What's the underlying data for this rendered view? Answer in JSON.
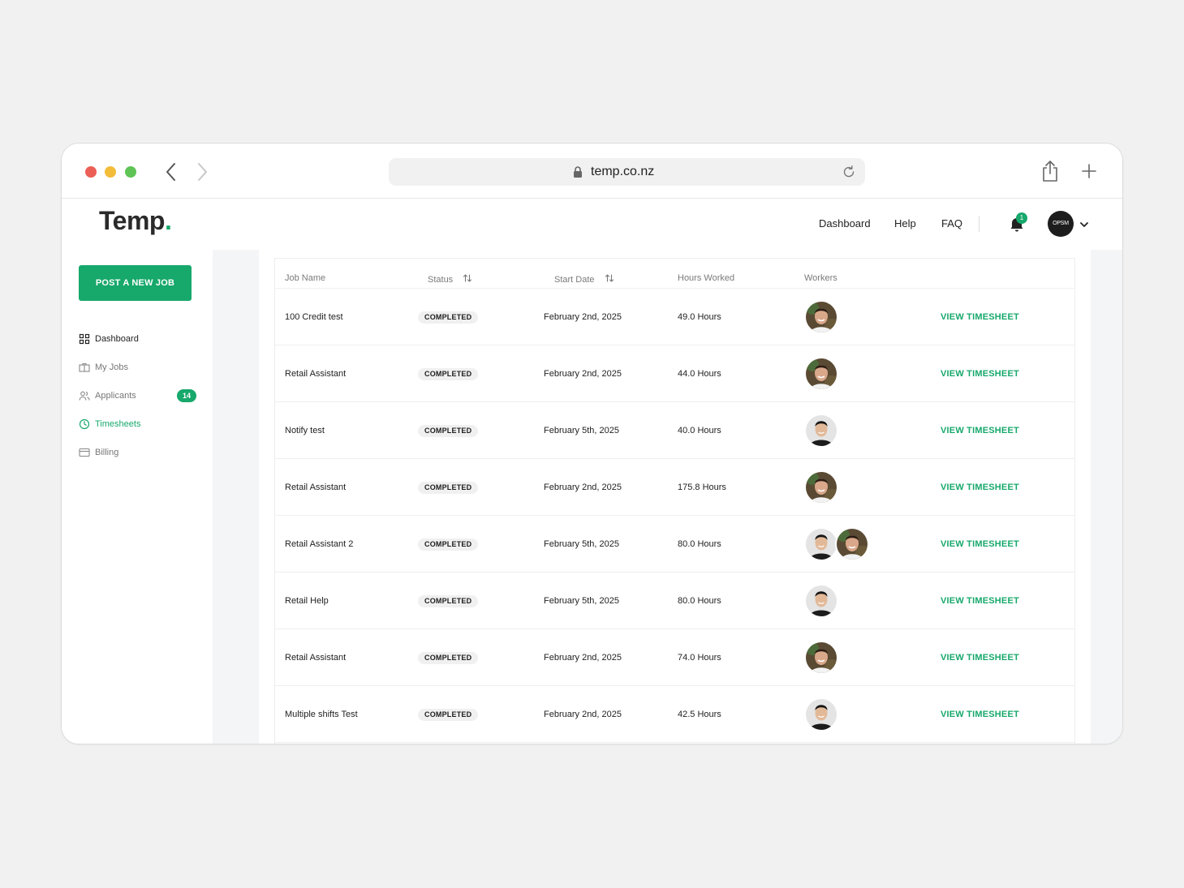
{
  "browser": {
    "url": "temp.co.nz"
  },
  "header": {
    "logo": "Temp",
    "logo_dot": ".",
    "nav": [
      "Dashboard",
      "Help",
      "FAQ"
    ],
    "notification_count": "1",
    "account_avatar": "OPSM"
  },
  "sidebar": {
    "post_button": "POST A NEW JOB",
    "items": [
      {
        "label": "Dashboard",
        "icon": "grid-icon"
      },
      {
        "label": "My Jobs",
        "icon": "briefcase-icon"
      },
      {
        "label": "Applicants",
        "icon": "users-icon",
        "badge": "14"
      },
      {
        "label": "Timesheets",
        "icon": "clock-icon"
      },
      {
        "label": "Billing",
        "icon": "card-icon"
      }
    ]
  },
  "table": {
    "columns": [
      "Job Name",
      "Status",
      "Start Date",
      "Hours Worked",
      "Workers"
    ],
    "rows": [
      {
        "job": "100 Credit test",
        "status": "COMPLETED",
        "start": "February 2nd, 2025",
        "hours": "49.0 Hours",
        "workers": [
          "A"
        ],
        "action": "VIEW TIMESHEET"
      },
      {
        "job": "Retail Assistant",
        "status": "COMPLETED",
        "start": "February 2nd, 2025",
        "hours": "44.0 Hours",
        "workers": [
          "A"
        ],
        "action": "VIEW TIMESHEET"
      },
      {
        "job": "Notify test",
        "status": "COMPLETED",
        "start": "February 5th, 2025",
        "hours": "40.0 Hours",
        "workers": [
          "B"
        ],
        "action": "VIEW TIMESHEET"
      },
      {
        "job": "Retail Assistant",
        "status": "COMPLETED",
        "start": "February 2nd, 2025",
        "hours": "175.8 Hours",
        "workers": [
          "A"
        ],
        "action": "VIEW TIMESHEET"
      },
      {
        "job": "Retail Assistant 2",
        "status": "COMPLETED",
        "start": "February 5th, 2025",
        "hours": "80.0 Hours",
        "workers": [
          "B",
          "A"
        ],
        "action": "VIEW TIMESHEET"
      },
      {
        "job": "Retail Help",
        "status": "COMPLETED",
        "start": "February 5th, 2025",
        "hours": "80.0 Hours",
        "workers": [
          "B"
        ],
        "action": "VIEW TIMESHEET"
      },
      {
        "job": "Retail Assistant",
        "status": "COMPLETED",
        "start": "February 2nd, 2025",
        "hours": "74.0 Hours",
        "workers": [
          "A"
        ],
        "action": "VIEW TIMESHEET"
      },
      {
        "job": "Multiple shifts Test",
        "status": "COMPLETED",
        "start": "February 2nd, 2025",
        "hours": "42.5 Hours",
        "workers": [
          "B"
        ],
        "action": "VIEW TIMESHEET"
      }
    ]
  },
  "colors": {
    "accent": "#17a86b",
    "gutter": "#f4f5f7"
  }
}
